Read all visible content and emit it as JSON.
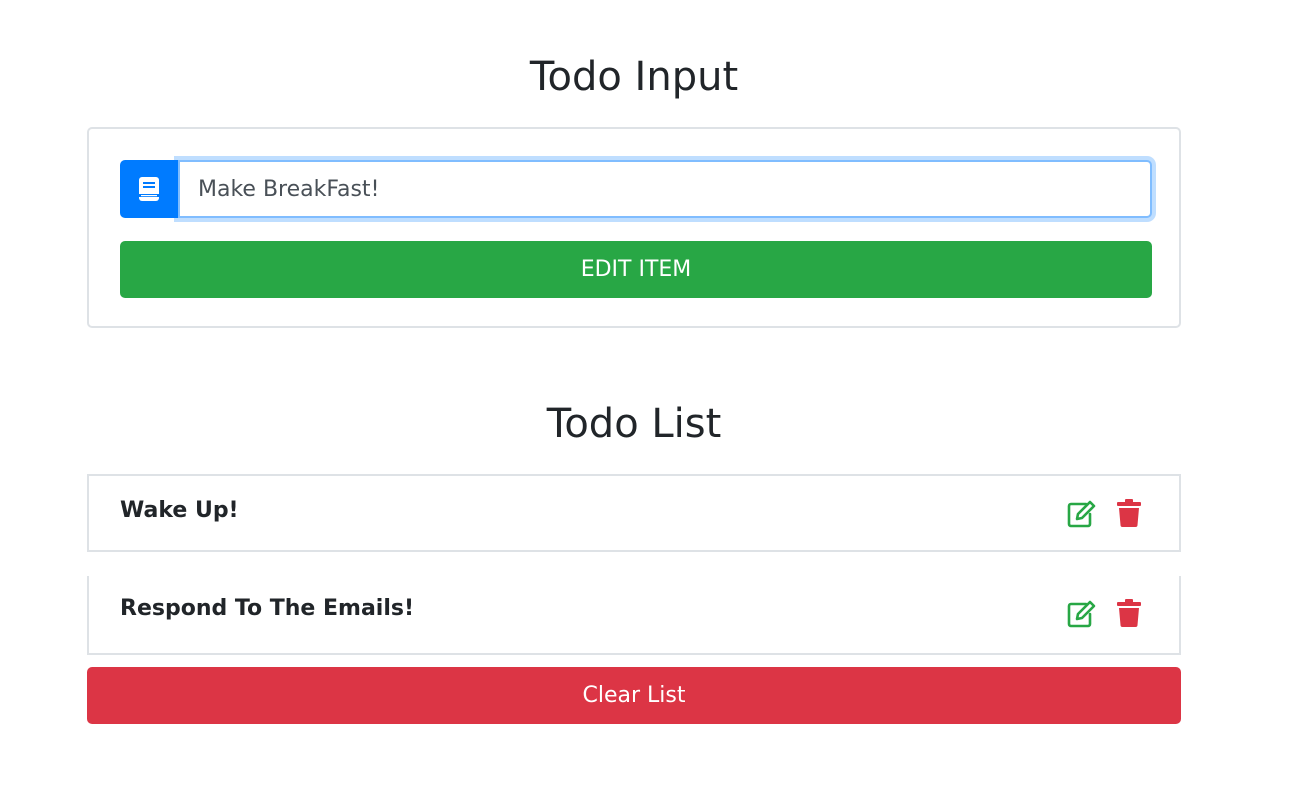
{
  "input_section": {
    "title": "Todo Input",
    "input_value": "Make BreakFast!",
    "input_icon": "book-icon",
    "edit_button_label": "EDIT ITEM"
  },
  "list_section": {
    "title": "Todo List",
    "items": [
      {
        "label": "Wake Up!",
        "edit_icon": "edit-icon",
        "delete_icon": "trash-icon"
      },
      {
        "label": "Respond To The Emails!",
        "edit_icon": "edit-icon",
        "delete_icon": "trash-icon"
      }
    ],
    "clear_button_label": "Clear List"
  },
  "colors": {
    "primary": "#007bff",
    "success": "#28a745",
    "danger": "#dc3545"
  }
}
